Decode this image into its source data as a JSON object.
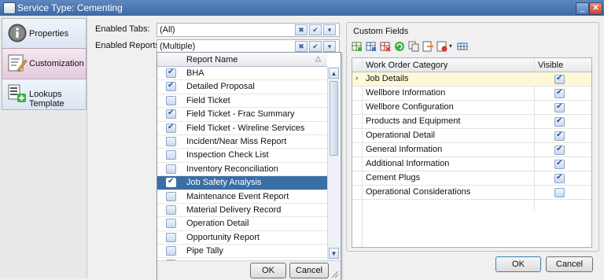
{
  "window": {
    "title": "Service Type: Cementing"
  },
  "nav": {
    "items": [
      {
        "label": "Properties",
        "icon": "info-icon",
        "selected": false
      },
      {
        "label": "Customization",
        "icon": "customization-icon",
        "selected": true
      },
      {
        "label": "Lookups Template",
        "icon": "lookups-template-icon",
        "selected": false
      }
    ]
  },
  "form": {
    "enabled_tabs_label": "Enabled Tabs:",
    "enabled_tabs_value": "(All)",
    "enabled_reports_label": "Enabled Reports:",
    "enabled_reports_value": "(Multiple)"
  },
  "reports_dropdown": {
    "header": "Report Name",
    "rows": [
      {
        "name": "BHA",
        "checked": true
      },
      {
        "name": "Detailed Proposal",
        "checked": true
      },
      {
        "name": "Field Ticket",
        "checked": false
      },
      {
        "name": "Field Ticket - Frac Summary",
        "checked": true
      },
      {
        "name": "Field Ticket - Wireline Services",
        "checked": true
      },
      {
        "name": "Incident/Near Miss Report",
        "checked": false
      },
      {
        "name": "Inspection Check List",
        "checked": false
      },
      {
        "name": "Inventory Reconciliation",
        "checked": false
      },
      {
        "name": "Job Safety Analysis",
        "checked": true,
        "selected": true
      },
      {
        "name": "Maintenance Event Report",
        "checked": false
      },
      {
        "name": "Material Delivery Record",
        "checked": false
      },
      {
        "name": "Operation Detail",
        "checked": false
      },
      {
        "name": "Opportunity Report",
        "checked": false
      },
      {
        "name": "Pipe Tally",
        "checked": false
      },
      {
        "name": "",
        "checked": false
      }
    ],
    "ok_label": "OK",
    "cancel_label": "Cancel"
  },
  "custom_fields": {
    "title": "Custom Fields",
    "columns": {
      "category": "Work Order Category",
      "visible": "Visible"
    },
    "rows": [
      {
        "category": "Job Details",
        "visible": true,
        "current": true
      },
      {
        "category": "Wellbore Information",
        "visible": true
      },
      {
        "category": "Wellbore Configuration",
        "visible": true
      },
      {
        "category": "Products and Equipment",
        "visible": true
      },
      {
        "category": "Operational Detail",
        "visible": true
      },
      {
        "category": "General Information",
        "visible": true
      },
      {
        "category": "Additional Information",
        "visible": true
      },
      {
        "category": "Cement Plugs",
        "visible": true
      },
      {
        "category": "Operational Considerations",
        "visible": false
      }
    ]
  },
  "footer": {
    "ok_label": "OK",
    "cancel_label": "Cancel"
  },
  "colors": {
    "titlebar": "#4a76b0",
    "selection": "#3a6ea5",
    "nav_selected": "#e3c9dc",
    "current_row": "#fdf9d8"
  }
}
